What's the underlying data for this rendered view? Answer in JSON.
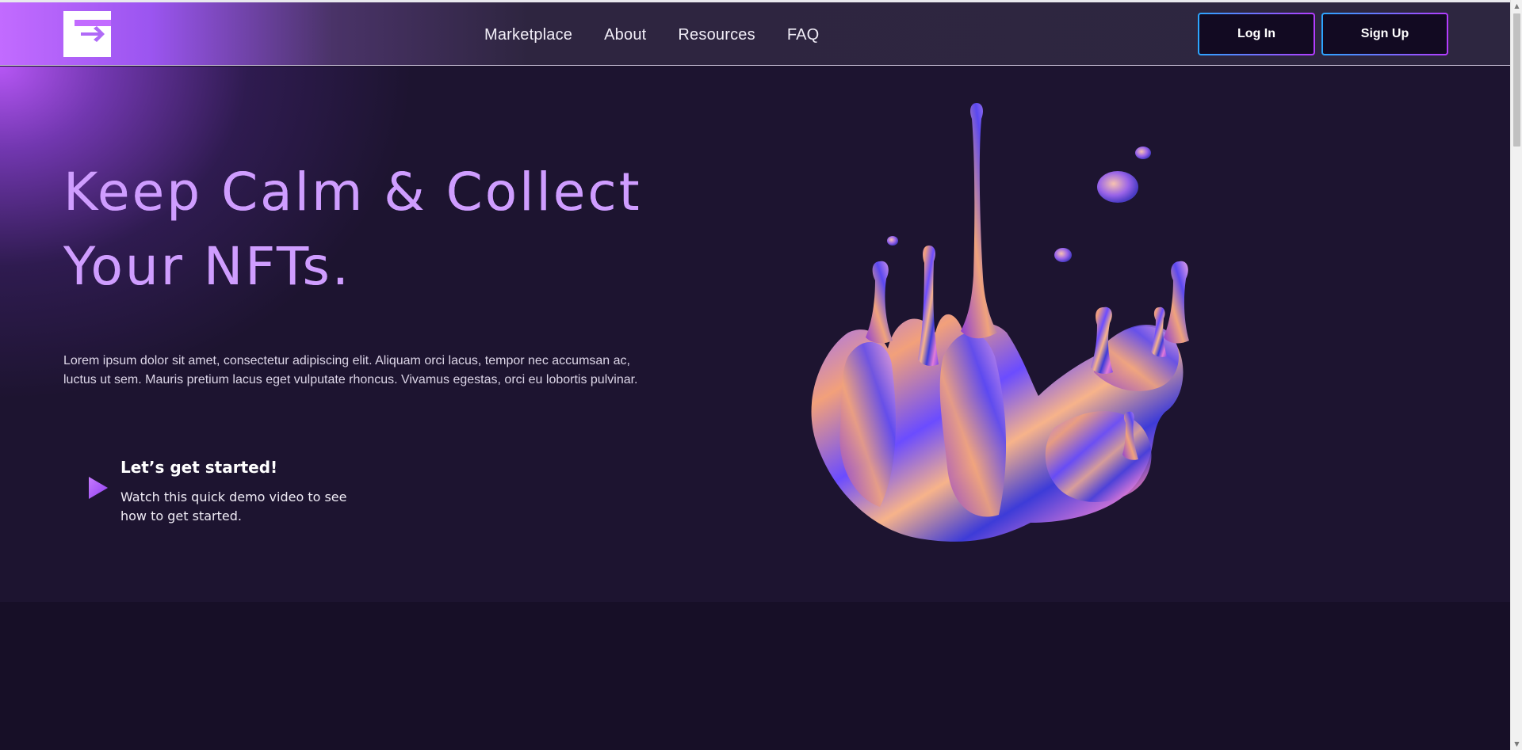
{
  "header": {
    "logo": "swap-logo",
    "nav": [
      {
        "label": "Marketplace"
      },
      {
        "label": "About"
      },
      {
        "label": "Resources"
      },
      {
        "label": "FAQ"
      }
    ],
    "login_label": "Log In",
    "signup_label": "Sign Up"
  },
  "hero": {
    "title_line1": "Keep Calm & Collect",
    "title_line2": "Your NFTs.",
    "description": "Lorem ipsum dolor sit amet, consectetur adipiscing elit. Aliquam orci lacus, tempor nec accumsan ac, luctus ut sem. Mauris pretium lacus eget vulputate rhoncus. Vivamus egestas, orci eu lobortis pulvinar.",
    "cta_title": "Let’s get started!",
    "cta_text": "Watch this quick demo video to see how to get started.",
    "cta_icon": "play-icon",
    "art": "liquid-chrome-splash"
  },
  "colors": {
    "background": "#1a1029",
    "accent_purple": "#b75cff",
    "title_gradient_start": "#d9a6ff",
    "button_border_start": "#2ba6ff",
    "button_border_end": "#b43bff"
  }
}
